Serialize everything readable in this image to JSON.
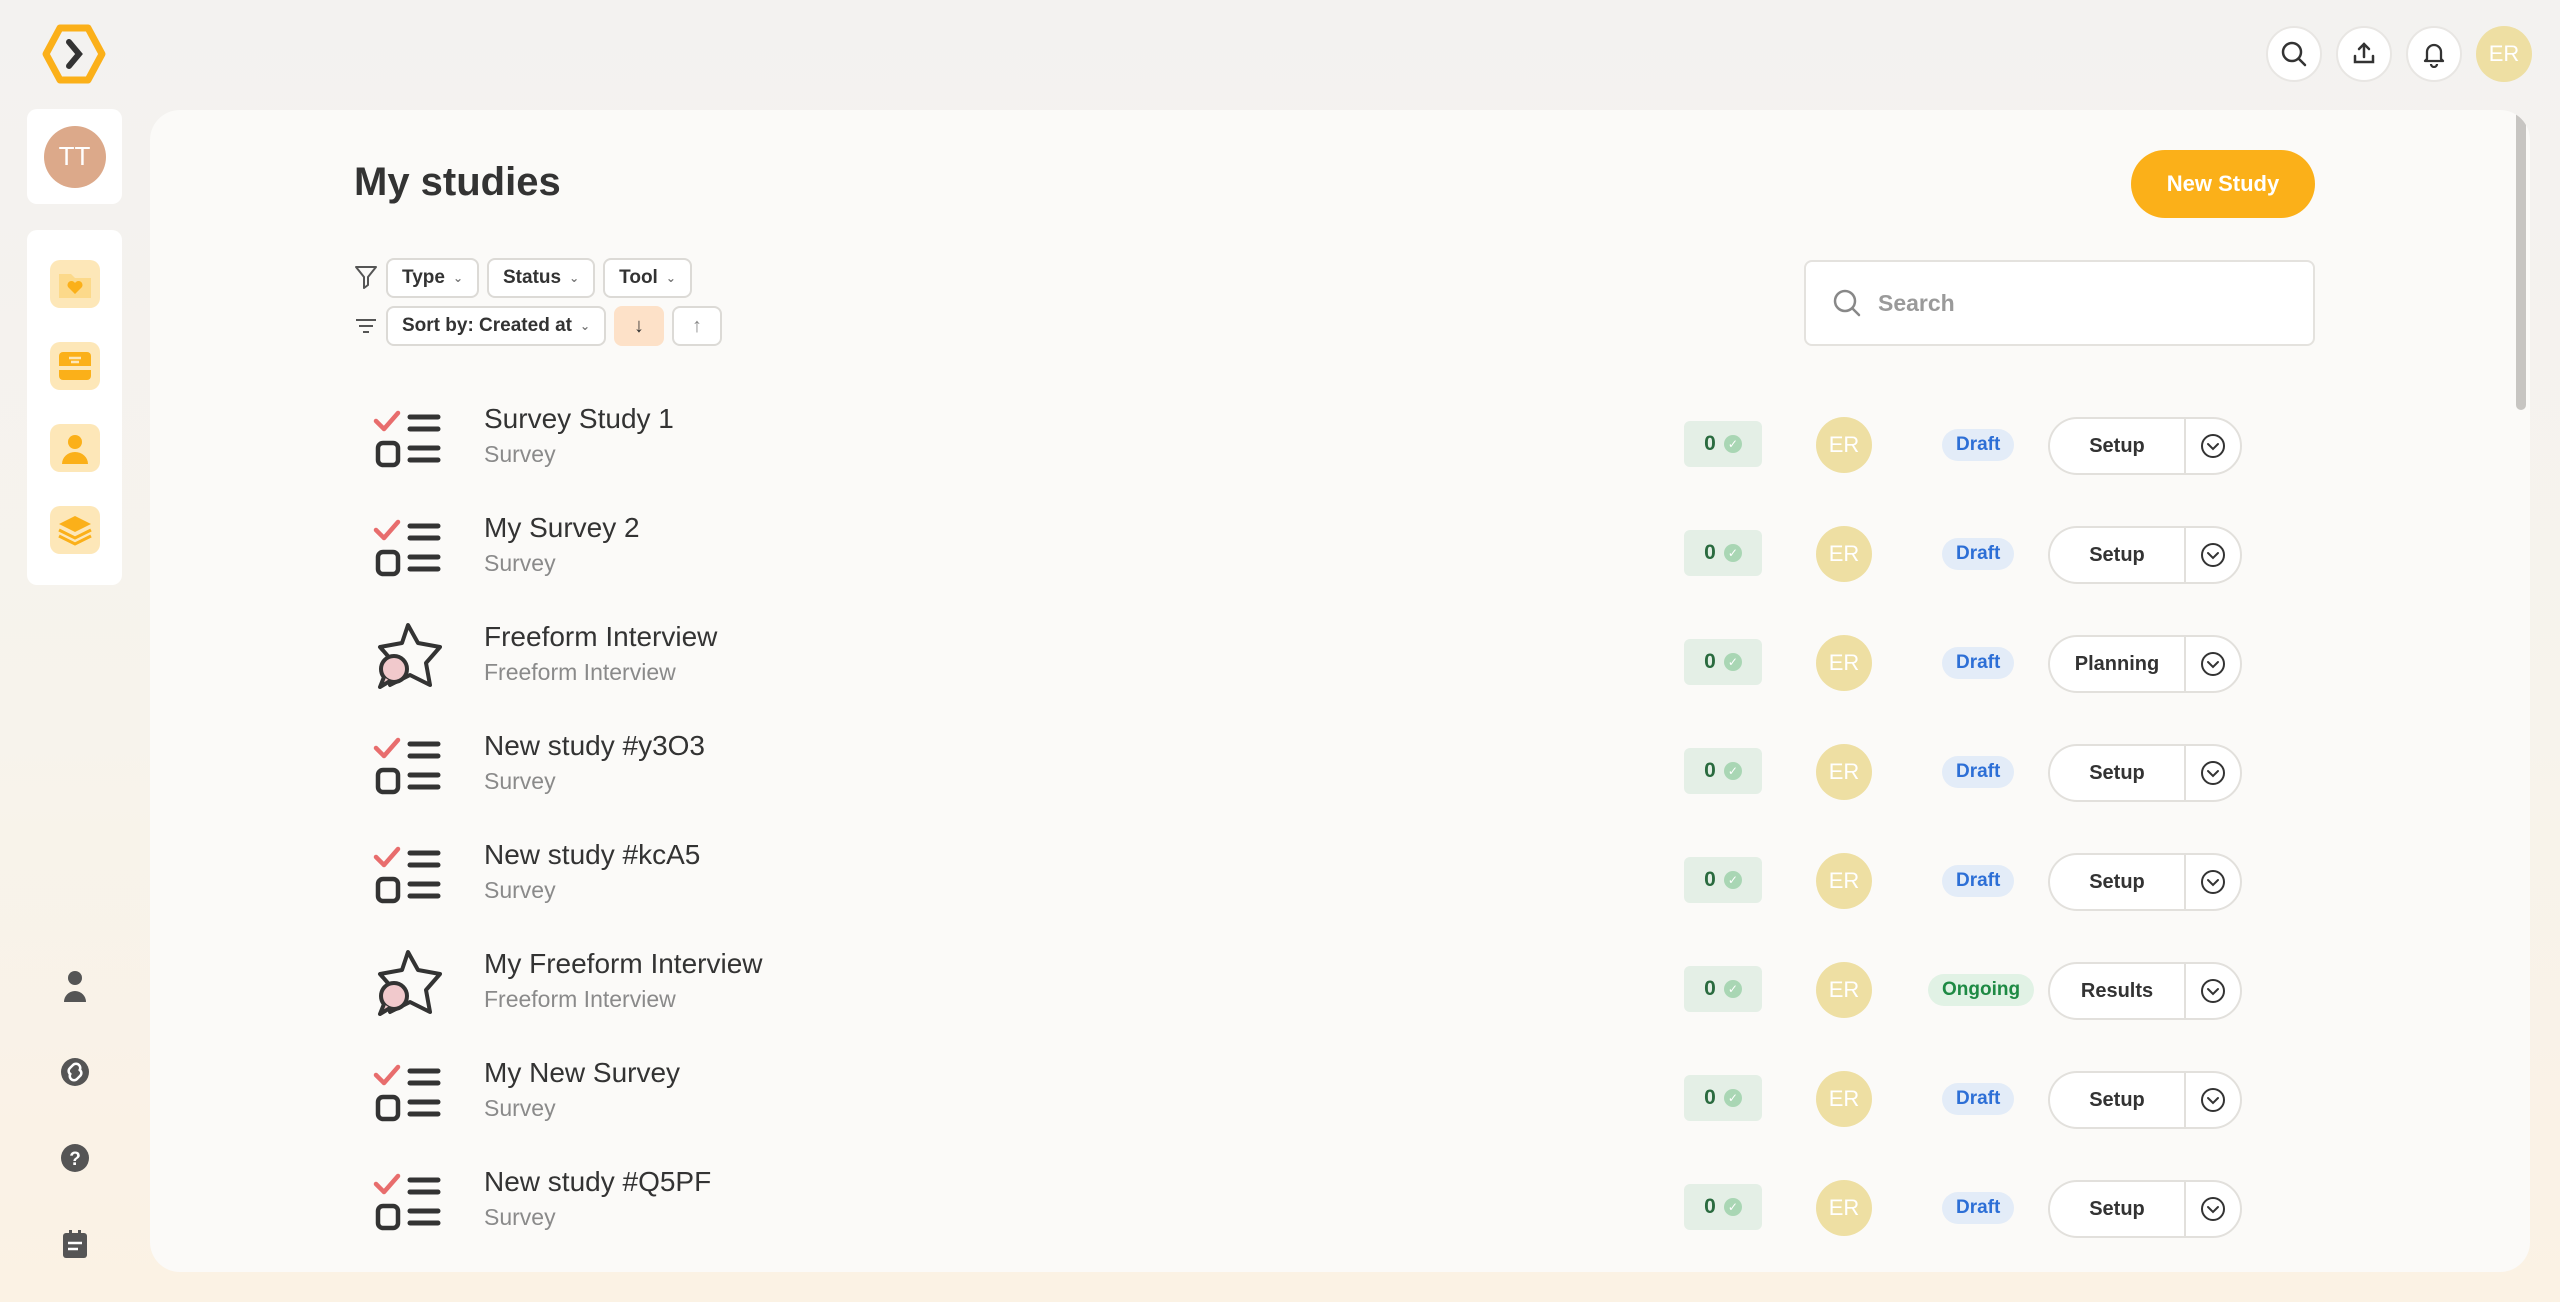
{
  "colors": {
    "accent": "#fbb019",
    "draft": "#2d6fd6",
    "ongoing": "#1e8a44"
  },
  "header": {
    "user_initials": "ER"
  },
  "sidebar": {
    "user_initials": "TT",
    "nav_items": [
      "folder-heart-icon",
      "inbox-icon",
      "person-icon",
      "layers-icon"
    ],
    "bottom_items": [
      "user-icon",
      "integrations-icon",
      "help-icon",
      "changelog-icon"
    ]
  },
  "main": {
    "title": "My studies",
    "new_study_label": "New Study",
    "filters": {
      "type": "Type",
      "status": "Status",
      "tool": "Tool",
      "sort": "Sort by: Created at"
    },
    "search": {
      "placeholder": "Search"
    },
    "studies": [
      {
        "title": "Survey Study 1",
        "subtitle": "Survey",
        "kind": "survey",
        "count": "0",
        "owner": "ER",
        "status": "Draft",
        "action": "Setup"
      },
      {
        "title": "My Survey 2",
        "subtitle": "Survey",
        "kind": "survey",
        "count": "0",
        "owner": "ER",
        "status": "Draft",
        "action": "Setup"
      },
      {
        "title": "Freeform Interview",
        "subtitle": "Freeform Interview",
        "kind": "interview",
        "count": "0",
        "owner": "ER",
        "status": "Draft",
        "action": "Planning"
      },
      {
        "title": "New study #y3O3",
        "subtitle": "Survey",
        "kind": "survey",
        "count": "0",
        "owner": "ER",
        "status": "Draft",
        "action": "Setup"
      },
      {
        "title": "New study #kcA5",
        "subtitle": "Survey",
        "kind": "survey",
        "count": "0",
        "owner": "ER",
        "status": "Draft",
        "action": "Setup"
      },
      {
        "title": "My Freeform Interview",
        "subtitle": "Freeform Interview",
        "kind": "interview",
        "count": "0",
        "owner": "ER",
        "status": "Ongoing",
        "action": "Results"
      },
      {
        "title": "My New Survey",
        "subtitle": "Survey",
        "kind": "survey",
        "count": "0",
        "owner": "ER",
        "status": "Draft",
        "action": "Setup"
      },
      {
        "title": "New study #Q5PF",
        "subtitle": "Survey",
        "kind": "survey",
        "count": "0",
        "owner": "ER",
        "status": "Draft",
        "action": "Setup"
      }
    ]
  }
}
